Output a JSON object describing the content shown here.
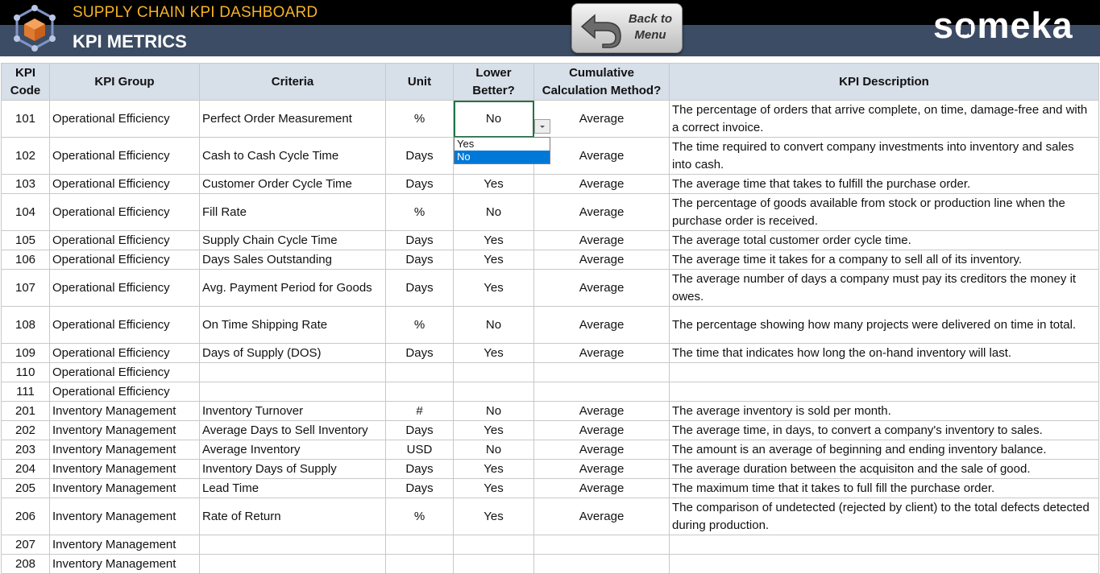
{
  "header": {
    "subtitle": "SUPPLY CHAIN KPI DASHBOARD",
    "title": "KPI METRICS",
    "back_button": [
      "Back to",
      "Menu"
    ],
    "brand": "someka",
    "icons": {
      "logo": "box-network-icon",
      "back": "back-arrow-icon"
    },
    "colors": {
      "top_bar": "#000000",
      "header_bg": "#3d4c65",
      "subtitle": "#f5b324",
      "table_header": "#d7dfe9"
    }
  },
  "table": {
    "headers": [
      "KPI Code",
      "KPI Group",
      "Criteria",
      "Unit",
      "Lower Better?",
      "Cumulative Calculation Method?",
      "KPI Description"
    ],
    "rows": [
      {
        "code": "101",
        "group": "Operational Efficiency",
        "criteria": "Perfect Order Measurement",
        "unit": "%",
        "lower": "No",
        "method": "Average",
        "desc": "The percentage of orders that arrive complete, on time, damage-free and with a correct invoice."
      },
      {
        "code": "102",
        "group": "Operational Efficiency",
        "criteria": "Cash to Cash Cycle Time",
        "unit": "Days",
        "lower": "",
        "method": "Average",
        "desc": "The time required to convert company investments into inventory and sales into cash."
      },
      {
        "code": "103",
        "group": "Operational Efficiency",
        "criteria": "Customer Order Cycle Time",
        "unit": "Days",
        "lower": "Yes",
        "method": "Average",
        "desc": "The average time that takes to fulfill the purchase order."
      },
      {
        "code": "104",
        "group": "Operational Efficiency",
        "criteria": "Fill Rate",
        "unit": "%",
        "lower": "No",
        "method": "Average",
        "desc": "The percentage of goods available from stock or production line when the purchase order is received."
      },
      {
        "code": "105",
        "group": "Operational Efficiency",
        "criteria": "Supply Chain Cycle Time",
        "unit": "Days",
        "lower": "Yes",
        "method": "Average",
        "desc": "The average total customer order cycle time."
      },
      {
        "code": "106",
        "group": "Operational Efficiency",
        "criteria": "Days Sales Outstanding",
        "unit": "Days",
        "lower": "Yes",
        "method": "Average",
        "desc": "The average time it takes for a company to sell all of its inventory."
      },
      {
        "code": "107",
        "group": "Operational Efficiency",
        "criteria": "Avg. Payment Period for Goods",
        "unit": "Days",
        "lower": "Yes",
        "method": "Average",
        "desc": "The average number of days a company must pay its creditors the money it owes."
      },
      {
        "code": "108",
        "group": "Operational Efficiency",
        "criteria": "On Time Shipping Rate",
        "unit": "%",
        "lower": "No",
        "method": "Average",
        "desc": "The percentage showing how many projects were delivered on time in total."
      },
      {
        "code": "109",
        "group": "Operational Efficiency",
        "criteria": "Days of Supply (DOS)",
        "unit": "Days",
        "lower": "Yes",
        "method": "Average",
        "desc": "The time that indicates how long the on-hand inventory will last."
      },
      {
        "code": "110",
        "group": "Operational Efficiency",
        "criteria": "",
        "unit": "",
        "lower": "",
        "method": "",
        "desc": ""
      },
      {
        "code": "111",
        "group": "Operational Efficiency",
        "criteria": "",
        "unit": "",
        "lower": "",
        "method": "",
        "desc": ""
      },
      {
        "code": "201",
        "group": "Inventory Management",
        "criteria": "Inventory Turnover",
        "unit": "#",
        "lower": "No",
        "method": "Average",
        "desc": "The average inventory is sold per month."
      },
      {
        "code": "202",
        "group": "Inventory Management",
        "criteria": "Average Days to Sell Inventory",
        "unit": "Days",
        "lower": "Yes",
        "method": "Average",
        "desc": "The average time, in days, to convert a company's inventory to sales."
      },
      {
        "code": "203",
        "group": "Inventory Management",
        "criteria": "Average Inventory",
        "unit": "USD",
        "lower": "No",
        "method": "Average",
        "desc": "The amount is an average of beginning and ending inventory balance."
      },
      {
        "code": "204",
        "group": "Inventory Management",
        "criteria": "Inventory Days of Supply",
        "unit": "Days",
        "lower": "Yes",
        "method": "Average",
        "desc": "The average duration between the acquisiton and the sale of good."
      },
      {
        "code": "205",
        "group": "Inventory Management",
        "criteria": "Lead Time",
        "unit": "Days",
        "lower": "Yes",
        "method": "Average",
        "desc": "The maximum time that it takes to full fill the purchase order."
      },
      {
        "code": "206",
        "group": "Inventory Management",
        "criteria": "Rate of Return",
        "unit": "%",
        "lower": "Yes",
        "method": "Average",
        "desc": "The comparison of undetected (rejected by client) to the total defects detected during production."
      },
      {
        "code": "207",
        "group": "Inventory Management",
        "criteria": "",
        "unit": "",
        "lower": "",
        "method": "",
        "desc": ""
      },
      {
        "code": "208",
        "group": "Inventory Management",
        "criteria": "",
        "unit": "",
        "lower": "",
        "method": "",
        "desc": ""
      }
    ]
  },
  "dropdown": {
    "options": [
      "Yes",
      "No"
    ],
    "highlighted": "No"
  }
}
